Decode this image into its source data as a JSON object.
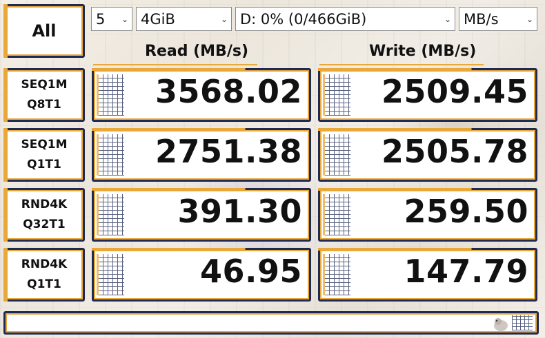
{
  "controls": {
    "all_label": "All",
    "count_value": "5",
    "size_value": "4GiB",
    "drive_value": "D: 0% (0/466GiB)",
    "unit_value": "MB/s"
  },
  "headers": {
    "read": "Read (MB/s)",
    "write": "Write (MB/s)"
  },
  "rows": [
    {
      "line1": "SEQ1M",
      "line2": "Q8T1",
      "read": "3568.02",
      "write": "2509.45"
    },
    {
      "line1": "SEQ1M",
      "line2": "Q1T1",
      "read": "2751.38",
      "write": "2505.78"
    },
    {
      "line1": "RND4K",
      "line2": "Q32T1",
      "read": "391.30",
      "write": "259.50"
    },
    {
      "line1": "RND4K",
      "line2": "Q1T1",
      "read": "46.95",
      "write": "147.79"
    }
  ],
  "status": {
    "text": ""
  },
  "colors": {
    "frame": "#1f2a55",
    "accent": "#e9a83a"
  }
}
